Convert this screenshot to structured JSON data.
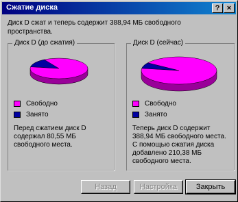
{
  "window": {
    "title": "Сжатие диска",
    "help_label": "?",
    "close_label": "×"
  },
  "message": "Диск D сжат и теперь содержит 388,94 МБ свободного пространства.",
  "before": {
    "legend": "Диск D (до сжатия)",
    "free_label": "Свободно",
    "used_label": "Занято",
    "description": "Перед сжатием диск D содержал 80,55 МБ свободного места.",
    "free_fraction": 0.86
  },
  "after": {
    "legend": "Диск D (сейчас)",
    "free_label": "Свободно",
    "used_label": "Занято",
    "description": "Теперь диск D содержит 388,94 МБ свободного места. С помощью сжатия диска добавлено 210,38 МБ свободного места.",
    "free_fraction": 0.93
  },
  "colors": {
    "free": "#ff00ff",
    "used": "#0000a0",
    "pie_side": "#990099",
    "pie_side_used": "#000060"
  },
  "buttons": {
    "back_label": "Назад",
    "next_label": "Настройка",
    "close_label": "Закрыть"
  }
}
